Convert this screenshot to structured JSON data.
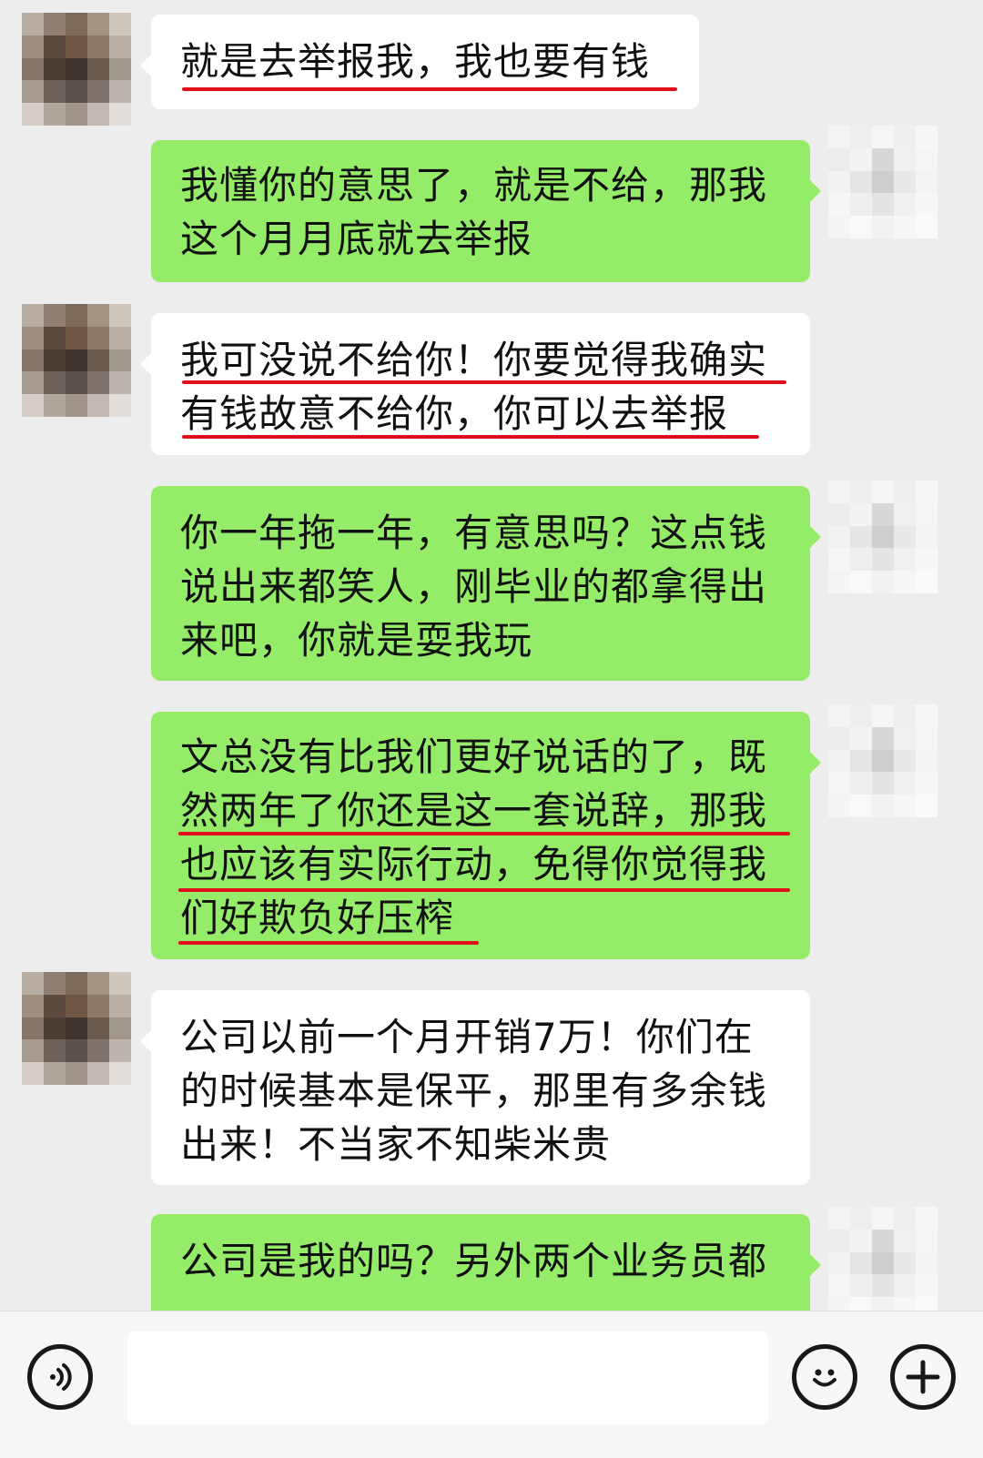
{
  "messages": [
    {
      "side": "left",
      "text": "就是去举报我，我也要有钱"
    },
    {
      "side": "right",
      "text": "我懂你的意思了，就是不给，那我这个月月底就去举报"
    },
    {
      "side": "left",
      "text": "我可没说不给你！你要觉得我确实有钱故意不给你，你可以去举报"
    },
    {
      "side": "right",
      "text": "你一年拖一年，有意思吗？这点钱说出来都笑人，刚毕业的都拿得出来吧，你就是耍我玩"
    },
    {
      "side": "right",
      "text": "文总没有比我们更好说话的了，既然两年了你还是这一套说辞，那我也应该有实际行动，免得你觉得我们好欺负好压榨"
    },
    {
      "side": "left",
      "text": "公司以前一个月开销7万！你们在的时候基本是保平，那里有多余钱出来！不当家不知柴米贵"
    },
    {
      "side": "right",
      "text": "公司是我的吗？另外两个业务员都"
    }
  ],
  "input_bar": {
    "voice_icon": "voice-icon",
    "emoji_icon": "emoji-icon",
    "plus_icon": "plus-icon"
  },
  "colors": {
    "background": "#ededed",
    "self_bubble": "#95ec69",
    "other_bubble": "#ffffff",
    "underline": "#e0101a"
  }
}
